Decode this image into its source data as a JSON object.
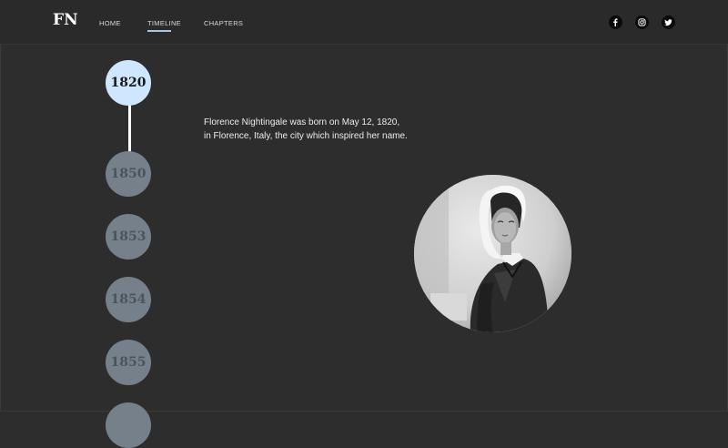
{
  "header": {
    "logo": "FN",
    "nav": [
      {
        "label": "HOME"
      },
      {
        "label": "TIMELINE",
        "active": true
      },
      {
        "label": "CHAPTERS"
      }
    ],
    "social_icons": [
      "facebook-icon",
      "instagram-icon",
      "twitter-icon"
    ],
    "accent_color": "#a9c4de"
  },
  "timeline": {
    "years": [
      {
        "label": "1820",
        "active": true
      },
      {
        "label": "1850"
      },
      {
        "label": "1853"
      },
      {
        "label": "1854"
      },
      {
        "label": "1855"
      },
      {
        "label": ""
      }
    ],
    "active_color": "#cfe6ff",
    "inactive_color": "#75808b"
  },
  "content": {
    "description_lines": [
      "Florence Nightingale was born on May 12, 1820,",
      "in Florence, Italy, the city which inspired her name."
    ]
  }
}
